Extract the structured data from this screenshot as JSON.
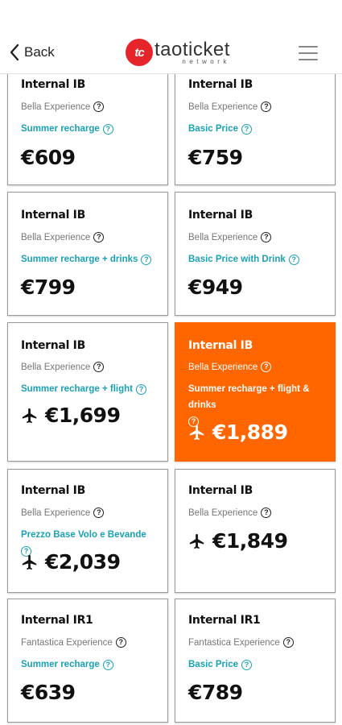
{
  "header": {
    "back_label": "Back",
    "logo_main": "taoticket",
    "logo_sub": "network",
    "logo_mark": "tc"
  },
  "offers": [
    {
      "title": "Internal IB",
      "experience": "Bella Experience",
      "plan": "Summer recharge",
      "price": "€609",
      "flight": false,
      "selected": false
    },
    {
      "title": "Internal IB",
      "experience": "Bella Experience",
      "plan": "Basic Price",
      "price": "€759",
      "flight": false,
      "selected": false
    },
    {
      "title": "Internal IB",
      "experience": "Bella Experience",
      "plan": "Summer recharge + drinks",
      "price": "€799",
      "flight": false,
      "selected": false
    },
    {
      "title": "Internal IB",
      "experience": "Bella Experience",
      "plan": "Basic Price with Drink",
      "price": "€949",
      "flight": false,
      "selected": false
    },
    {
      "title": "Internal IB",
      "experience": "Bella Experience",
      "plan": "Summer recharge + flight",
      "price": "€1,699",
      "flight": true,
      "selected": false
    },
    {
      "title": "Internal IB",
      "experience": "Bella Experience",
      "plan": "Summer recharge + flight & drinks",
      "price": "€1,889",
      "flight": true,
      "selected": true
    },
    {
      "title": "Internal IB",
      "experience": "Bella Experience",
      "plan": "Prezzo Base Volo e Bevande",
      "price": "€2,039",
      "flight": true,
      "selected": false
    },
    {
      "title": "Internal IB",
      "experience": "Bella Experience",
      "plan": "",
      "price": "€1,849",
      "flight": true,
      "selected": false
    },
    {
      "title": "Internal IR1",
      "experience": "Fantastica Experience",
      "plan": "Summer recharge",
      "price": "€639",
      "flight": false,
      "selected": false
    },
    {
      "title": "Internal IR1",
      "experience": "Fantastica Experience",
      "plan": "Basic Price",
      "price": "€789",
      "flight": false,
      "selected": false
    }
  ],
  "colors": {
    "accent": "#ff6600",
    "plan_text": "#1aa1b5",
    "brand_red": "#e52529"
  },
  "icons": {
    "back": "chevron-left-icon",
    "menu": "hamburger-menu-icon",
    "info": "question-circle-icon",
    "flight": "airplane-icon"
  }
}
